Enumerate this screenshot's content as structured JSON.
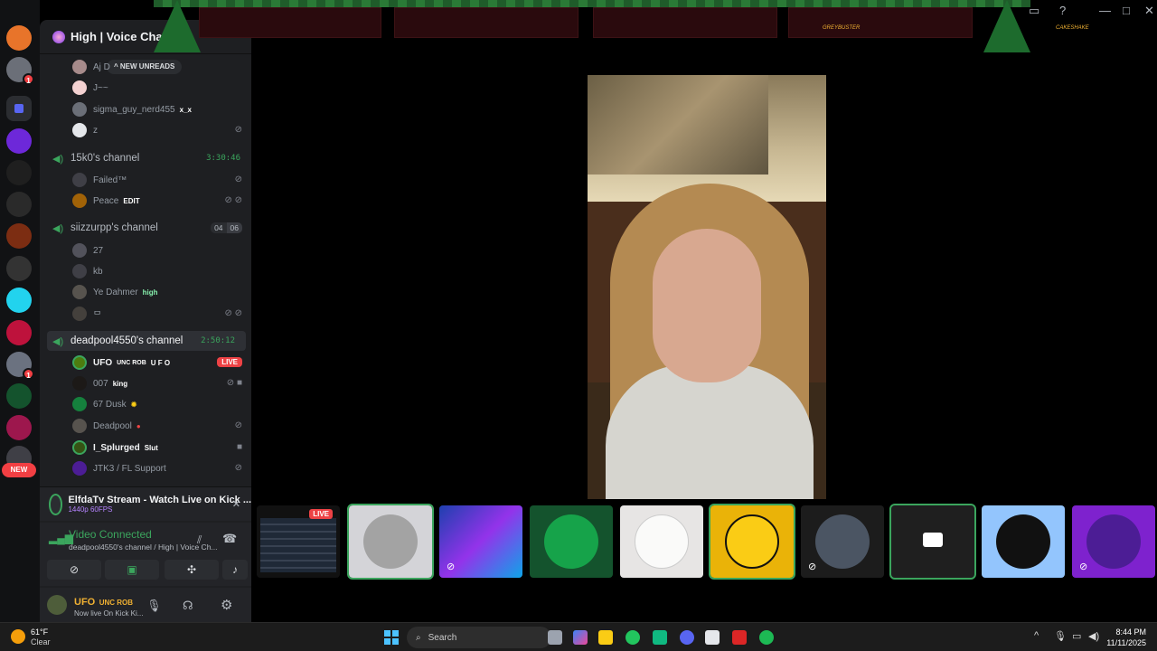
{
  "sidebar": {
    "server_title": "High | Voice Chat",
    "new_unreads": "NEW UNREADS",
    "top_users": [
      {
        "name": "Aj D",
        "tag": ""
      },
      {
        "name": "J~~",
        "tag": ""
      },
      {
        "name": "sigma_guy_nerd455",
        "tag": "x_x"
      },
      {
        "name": "z",
        "tag": ""
      }
    ],
    "channels": [
      {
        "name": "15k0's channel",
        "timer": "3:30:46",
        "users": [
          {
            "name": "Failed™",
            "tag": ""
          },
          {
            "name": "Peace",
            "tag": "EDIT"
          }
        ]
      },
      {
        "name": "siizzurpp's channel",
        "count_a": "04",
        "count_b": "06",
        "users": [
          {
            "name": "27",
            "tag": ""
          },
          {
            "name": "kb",
            "tag": ""
          },
          {
            "name": "Ye Dahmer",
            "tag": "high"
          },
          {
            "name": "ᄆ",
            "tag": ""
          }
        ]
      },
      {
        "name": "deadpool4550's channel",
        "timer": "2:50:12",
        "users": [
          {
            "name": "UFO",
            "name_suffix": "UNC ROB",
            "tag": "U F O",
            "live": "LIVE"
          },
          {
            "name": "007",
            "tag": "king"
          },
          {
            "name": "67 Dusk",
            "tag": ""
          },
          {
            "name": "Deadpool",
            "tag": ""
          },
          {
            "name": "I_Splurged",
            "tag": "Slut"
          },
          {
            "name": "JTK3 / FL Support",
            "tag": ""
          }
        ]
      }
    ]
  },
  "rail": {
    "new_label": "NEW",
    "badge_1": "1",
    "badge_2": "1"
  },
  "activity": {
    "title": "ElfdaTv Stream - Watch Live on Kick ...",
    "sub": "1440p 60FPS"
  },
  "voice": {
    "title": "Video Connected",
    "subtitle": "deadpool4550's channel / High | Voice Ch..."
  },
  "user_panel": {
    "name": "UFO",
    "name_suffix": "UNC ROB",
    "status": "Now live On Kick Ki..."
  },
  "banner": {
    "left_text": "GREYBUSTER",
    "right_text": "CAKESHAKE"
  },
  "tiles": [
    {
      "kind": "screen",
      "live": "LIVE"
    },
    {
      "kind": "avatar",
      "speaking": true
    },
    {
      "kind": "screen"
    },
    {
      "kind": "avatar"
    },
    {
      "kind": "avatar"
    },
    {
      "kind": "avatar",
      "speaking": true
    },
    {
      "kind": "avatar"
    },
    {
      "kind": "camera-off",
      "speaking": true
    },
    {
      "kind": "avatar"
    },
    {
      "kind": "avatar"
    }
  ],
  "taskbar": {
    "temp": "61°F",
    "condition": "Clear",
    "search_label": "Search",
    "time": "8:44 PM",
    "date": "11/11/2025"
  }
}
